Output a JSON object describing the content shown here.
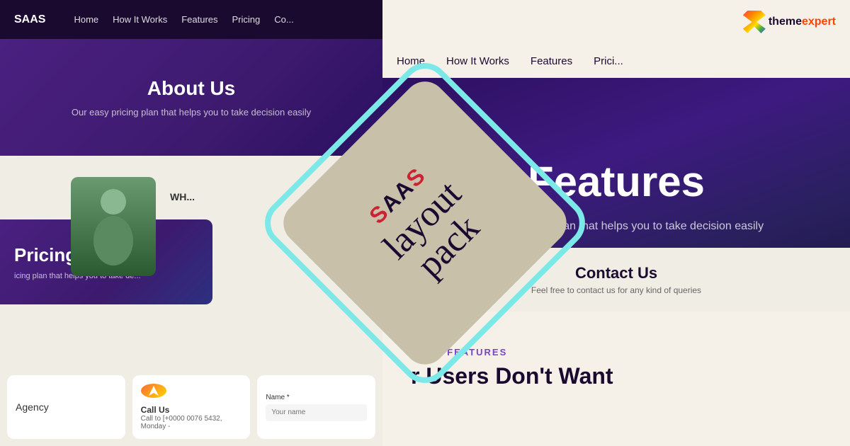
{
  "left_nav": {
    "logo": "SAAS",
    "links": [
      "Home",
      "How It Works",
      "Features",
      "Pricing",
      "Co..."
    ]
  },
  "about_us": {
    "title": "About Us",
    "subtitle": "Our easy pricing plan that helps you to take decision easily"
  },
  "pricing": {
    "title": "Pricing Pl...",
    "subtitle": "icing plan that helps you to take de..."
  },
  "diamond": {
    "saas_s1": "S",
    "saas_aa": "AA",
    "saas_s2": "S",
    "layout": "layout",
    "pack": "pack"
  },
  "right_nav": {
    "links": [
      "Home",
      "How It Works",
      "Features",
      "Prici..."
    ],
    "logo_text": "theme",
    "logo_expert": "expert"
  },
  "features": {
    "title": "Features",
    "subtitle": "Our easy pricing plan that helps you to take decision easily"
  },
  "contact": {
    "title": "Contact Us",
    "subtitle": "Feel free to contact us for any kind of queries"
  },
  "breadcrumb": "Home",
  "core_features": {
    "label": "CORE FEATURES",
    "heading": "r Users Don't Want"
  },
  "cards": {
    "agency": "Agency",
    "call_us_title": "Call Us",
    "call_us_detail": "Call to [+0000 0076 5432, Monday -",
    "form_label": "Name *",
    "form_placeholder": "Your name"
  },
  "who_text": "WH..."
}
